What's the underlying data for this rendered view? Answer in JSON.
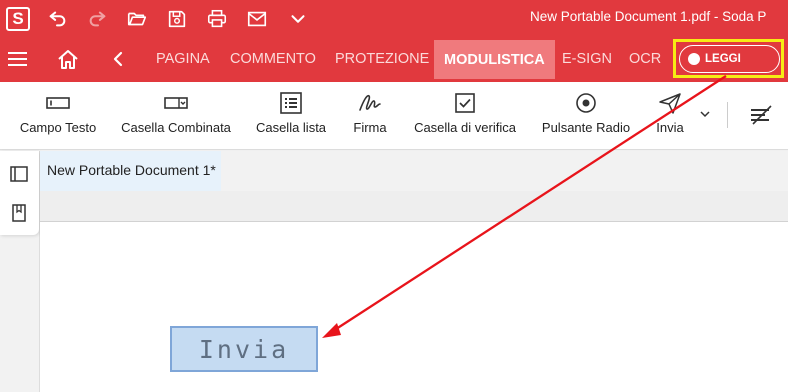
{
  "app": {
    "logo_letter": "S",
    "window_title": "New Portable Document 1.pdf   -   Soda P"
  },
  "quick_access": [
    "undo-icon",
    "redo-icon",
    "open-folder-icon",
    "save-icon",
    "print-icon",
    "email-icon",
    "chevron-down-icon"
  ],
  "ribbon": {
    "tabs": [
      {
        "label": "PAGINA",
        "active": false
      },
      {
        "label": "COMMENTO",
        "active": false
      },
      {
        "label": "PROTEZIONE",
        "active": false
      },
      {
        "label": "MODULISTICA",
        "active": true
      },
      {
        "label": "E-SIGN",
        "active": false
      },
      {
        "label": "OCR",
        "active": false
      }
    ],
    "read_toggle_label": "LEGGI"
  },
  "toolbar": {
    "tools": [
      {
        "label": "Campo Testo",
        "icon": "text-field-icon"
      },
      {
        "label": "Casella Combinata",
        "icon": "combo-box-icon"
      },
      {
        "label": "Casella lista",
        "icon": "list-box-icon"
      },
      {
        "label": "Firma",
        "icon": "signature-icon"
      },
      {
        "label": "Casella di verifica",
        "icon": "checkbox-icon"
      },
      {
        "label": "Pulsante Radio",
        "icon": "radio-button-icon"
      },
      {
        "label": "Invia",
        "icon": "send-icon"
      }
    ]
  },
  "document": {
    "tab_title": "New Portable Document 1*",
    "submit_field_text": "Invia"
  },
  "colors": {
    "brand_red": "#e1393e",
    "active_tab": "#f07a7d",
    "highlight_frame": "#f6ec14",
    "annotation_arrow": "#e8141b",
    "form_field_fill": "#c5dbf2"
  }
}
